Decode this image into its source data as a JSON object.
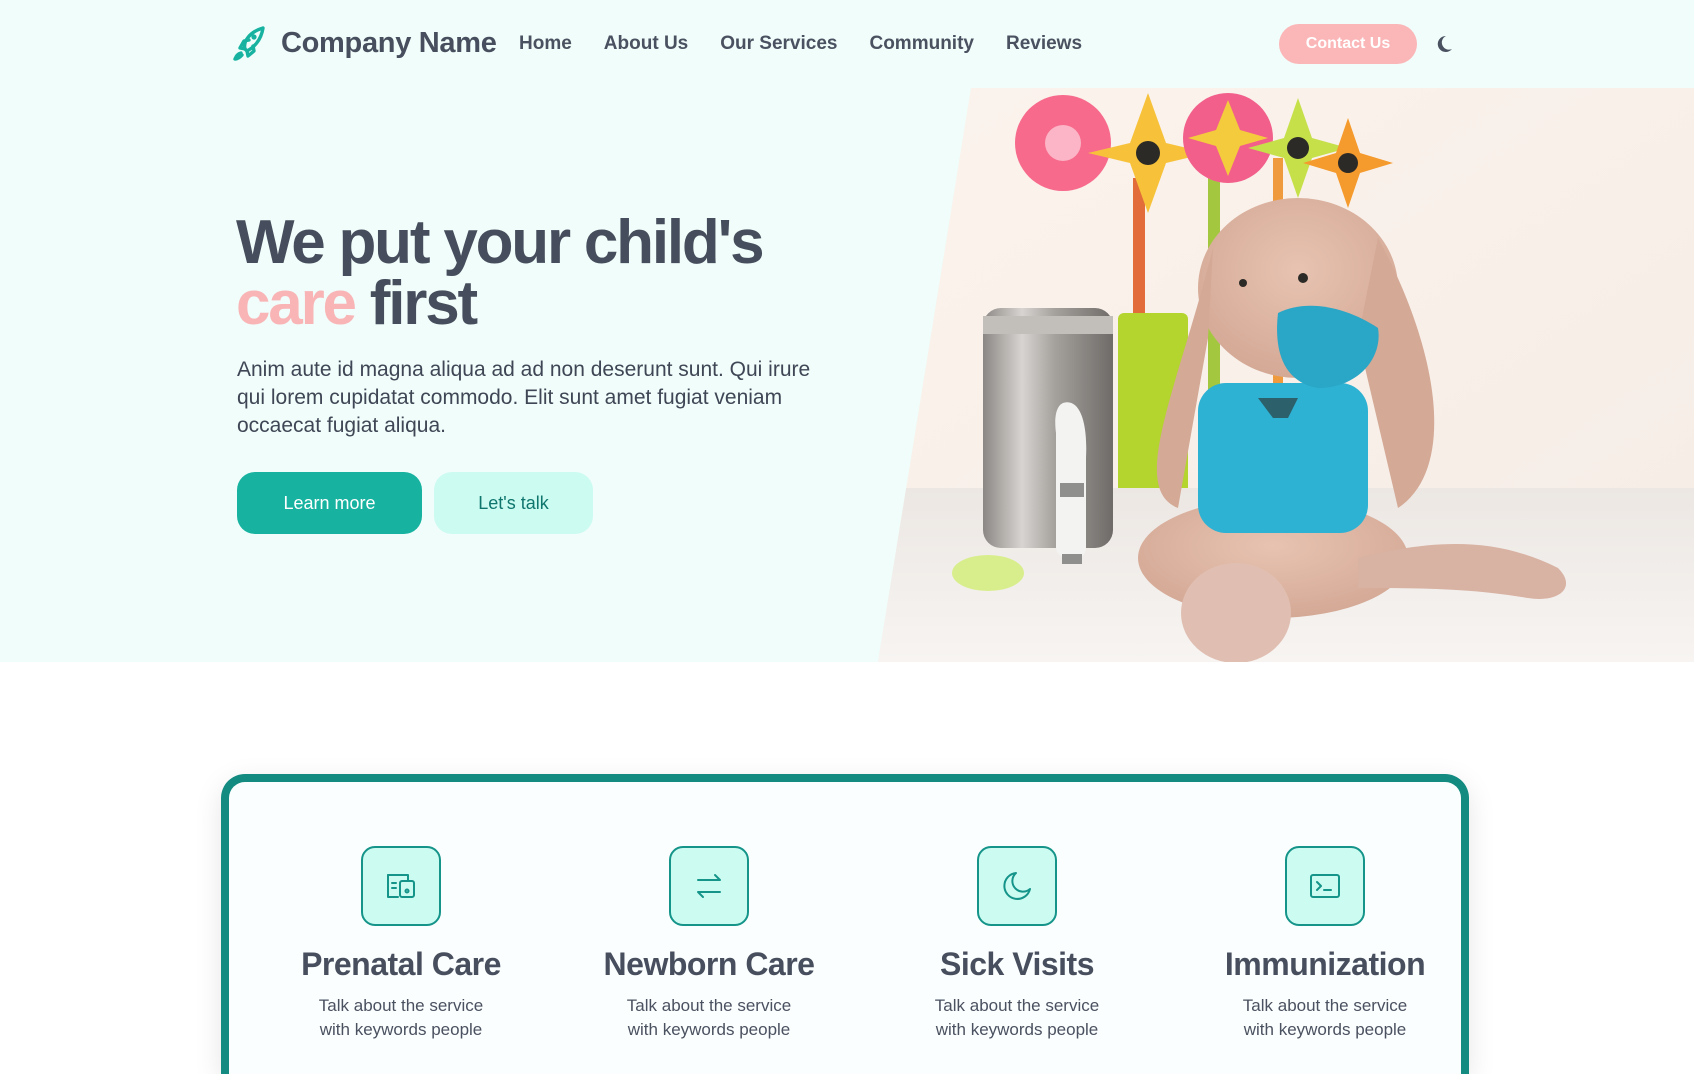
{
  "colors": {
    "brand_teal": "#17b3a0",
    "dark_teal": "#138b80",
    "accent_pink": "#f9b4b6",
    "hero_bg": "#f0fdfa",
    "text_dark": "#464d5c"
  },
  "header": {
    "logo_icon": "rocket-icon",
    "brand_name": "Company Name",
    "nav": [
      {
        "label": "Home"
      },
      {
        "label": "About Us"
      },
      {
        "label": "Our Services"
      },
      {
        "label": "Community"
      },
      {
        "label": "Reviews"
      }
    ],
    "contact_label": "Contact Us",
    "theme_toggle_icon": "moon-icon"
  },
  "hero": {
    "title_line1": "We put your child's",
    "title_accent": "care",
    "title_rest": " first",
    "description": "Anim aute id magna aliqua ad ad non deserunt sunt. Qui irure qui lorem cupidatat commodo. Elit sunt amet fugiat veniam occaecat fugiat aliqua.",
    "primary_button": "Learn more",
    "secondary_button": "Let's talk",
    "image_subject": "crocheted bunny toy wearing a face mask next to a thermometer and flower pinwheels"
  },
  "services": [
    {
      "icon": "device-icon",
      "title": "Prenatal Care",
      "desc": "Talk about the service with keywords people"
    },
    {
      "icon": "arrows-swap-icon",
      "title": "Newborn Care",
      "desc": "Talk about the service with keywords people"
    },
    {
      "icon": "moon-icon",
      "title": "Sick Visits",
      "desc": "Talk about the service with keywords people"
    },
    {
      "icon": "terminal-icon",
      "title": "Immunization",
      "desc": "Talk about the service with keywords people"
    }
  ]
}
